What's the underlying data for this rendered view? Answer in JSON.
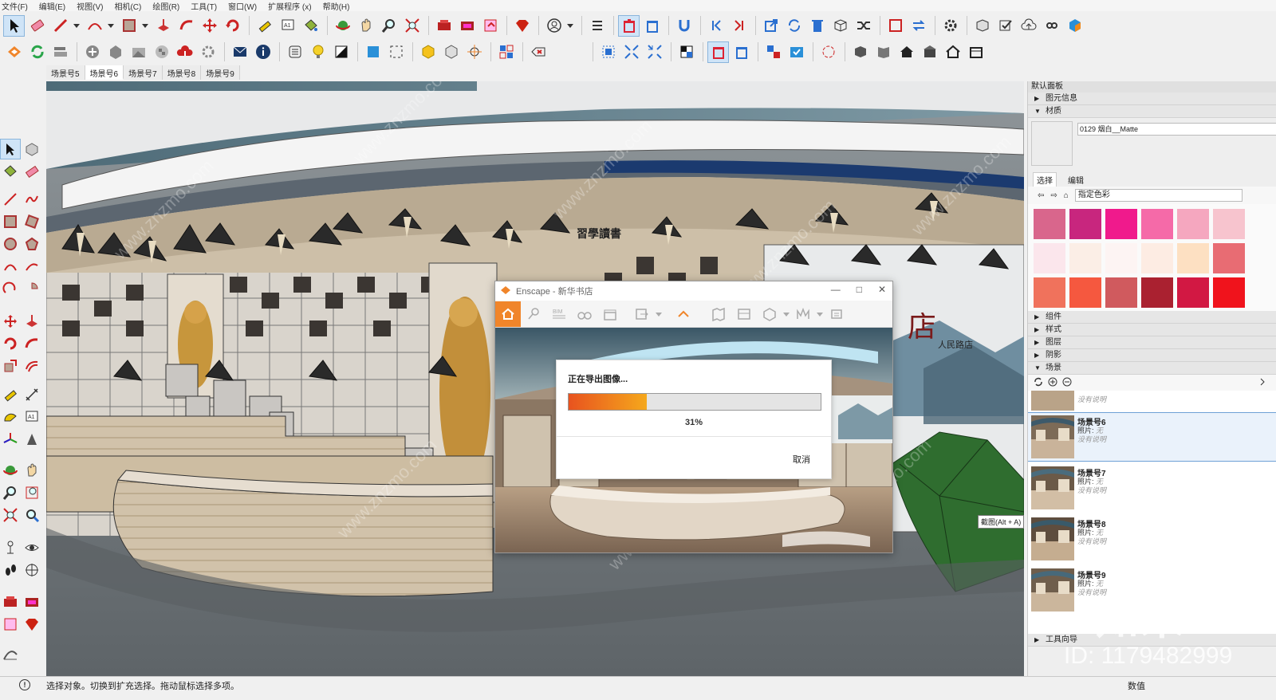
{
  "menu": [
    "文件(F)",
    "编辑(E)",
    "视图(V)",
    "相机(C)",
    "绘图(R)",
    "工具(T)",
    "窗口(W)",
    "扩展程序 (x)",
    "帮助(H)"
  ],
  "scene_tabs": [
    "场景号5",
    "场景号6",
    "场景号7",
    "场景号8",
    "场景号9"
  ],
  "active_scene_tab": "场景号6",
  "enscape": {
    "window_title": "Enscape - 新华书店",
    "toolbar_label_bim": "BIM",
    "export_dialog": {
      "title": "正在导出图像...",
      "progress": 0.31,
      "progress_label": "31%",
      "cancel_label": "取消"
    }
  },
  "right_panel": {
    "title": "默认面板",
    "sections": {
      "entity_info": "图元信息",
      "materials": "材质",
      "components": "组件",
      "styles": "样式",
      "layers": "图层",
      "shadows": "阴影",
      "scenes": "场景",
      "instructor": "工具向导"
    },
    "material_name": "0129 烟白__Matte",
    "material_tabs": [
      "选择",
      "编辑"
    ],
    "material_collection": "指定色彩",
    "swatch_colors": [
      "#d9668c",
      "#c8267e",
      "#f01a8c",
      "#f56aa8",
      "#f5a7bf",
      "#f7c4ce",
      "#fbe6ec",
      "#fbeee6",
      "#fdf4f3",
      "#fdece3",
      "#fde0c2",
      "#e86c73",
      "#f0725c",
      "#f5583f",
      "#d05a5e",
      "#aa2130",
      "#d21843",
      "#f0131c"
    ],
    "scenes": [
      {
        "name": "场景号6",
        "photo_label": "照片: ",
        "photo_value": "无",
        "description": "没有说明",
        "selected": true
      },
      {
        "name": "场景号7",
        "photo_label": "照片: ",
        "photo_value": "无",
        "description": "没有说明",
        "selected": false
      },
      {
        "name": "场景号8",
        "photo_label": "照片: ",
        "photo_value": "无",
        "description": "没有说明",
        "selected": false
      },
      {
        "name": "场景号9",
        "photo_label": "照片: ",
        "photo_value": "无",
        "description": "没有说明",
        "selected": false
      }
    ],
    "scenes_partial_desc": "没有说明"
  },
  "tooltip": "截图(Alt + A)",
  "statusbar": {
    "text": "选择对象。切换到扩充选择。拖动鼠标选择多项。",
    "measure_label": "数值"
  },
  "signage": {
    "top_sign": "習學讀書",
    "right_panel_text": "人民路店"
  },
  "watermarks": {
    "site": "www.znzmo.com",
    "logo": "知末",
    "id": "ID: 1179482999"
  },
  "colors": {
    "accent_orange": "#f0852a",
    "progress_start": "#e8531f",
    "progress_end": "#f5a81c",
    "selection_blue": "#6fa1d6"
  },
  "icons": {
    "toolbar1": [
      "select-arrow-icon",
      "eraser-icon",
      "pencil-line-icon",
      "arc-icon",
      "rectangle-icon",
      "push-pull-icon",
      "follow-me-icon",
      "move-icon",
      "rotate-icon",
      "tape-measure-icon",
      "text-icon",
      "paint-bucket-icon",
      "orbit-icon",
      "pan-icon",
      "zoom-icon",
      "zoom-extents-icon",
      "warehouse-icon",
      "extension-warehouse-icon",
      "share-model-icon",
      "ruby-icon",
      "account-icon",
      "outliner-icon",
      "delete-plugin-icon",
      "cleanup-icon",
      "magnet-icon",
      "prev-icon",
      "next-icon",
      "export-icon",
      "sync-icon",
      "trash-icon",
      "box-icon",
      "shuffle-icon",
      "bounding-box-icon",
      "swap-icon",
      "settings-icon",
      "cube-icon",
      "check-icon",
      "cloud-upload-icon",
      "link-icon",
      "sketchup-logo-icon"
    ],
    "toolbar2": [
      "enscape-logo-icon",
      "enscape-sync-icon",
      "enscape-views-icon",
      "enscape-add-icon",
      "enscape-tree-icon",
      "enscape-sky-icon",
      "enscape-material-icon",
      "enscape-upload-icon",
      "enscape-settings-icon",
      "mail-icon",
      "info-icon",
      "list-icon",
      "light-icon",
      "half-square-icon",
      "blue-square-icon",
      "dashed-square-icon",
      "hexagon-yellow-icon",
      "hexagon-grey-icon",
      "target-icon",
      "grid-icon",
      "eraser-red-icon",
      "select-group-icon",
      "expand-icon",
      "collapse-icon",
      "contrast-icon",
      "delete-red-icon",
      "delete-blue-icon",
      "component-swap-icon",
      "component-check-icon",
      "flower-icon",
      "box-3d-icon",
      "book-icon",
      "house-icon",
      "store-icon",
      "home-outline-icon",
      "shop-icon"
    ]
  }
}
